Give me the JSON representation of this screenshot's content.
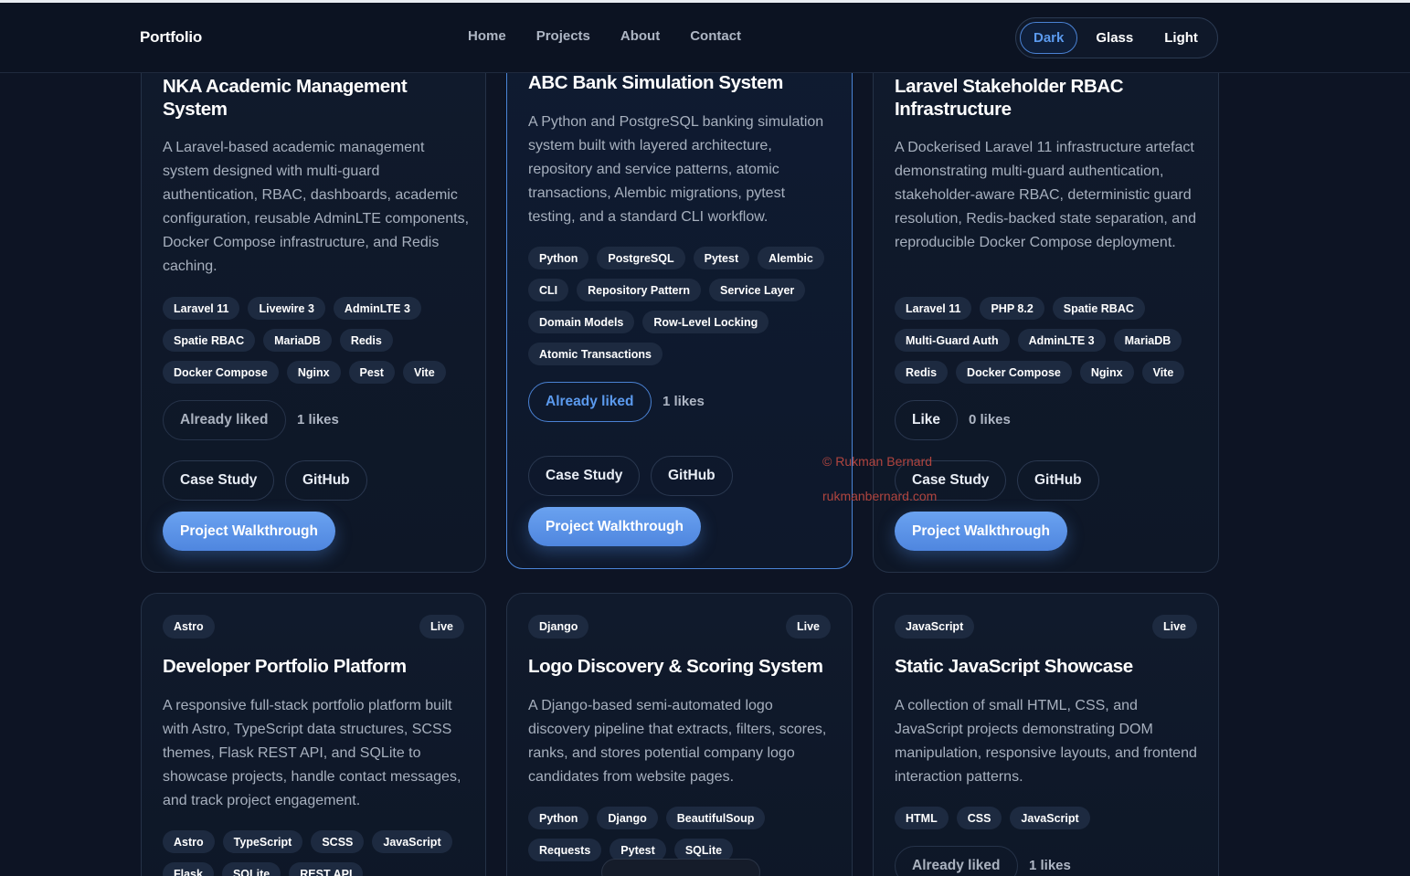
{
  "nav": {
    "brand": "Portfolio",
    "links": [
      "Home",
      "Projects",
      "About",
      "Contact"
    ],
    "themes": [
      "Dark",
      "Glass",
      "Light"
    ]
  },
  "cards": [
    {
      "title": "NKA Academic Management System",
      "description": "A Laravel-based academic management system designed with multi-guard authentication, RBAC, dashboards, academic configuration, reusable AdminLTE components, Docker Compose infrastructure, and Redis caching.",
      "tags": [
        "Laravel 11",
        "Livewire 3",
        "AdminLTE 3",
        "Spatie RBAC",
        "MariaDB",
        "Redis",
        "Docker Compose",
        "Nginx",
        "Pest",
        "Vite"
      ],
      "like_label": "Already liked",
      "likes": "1 likes",
      "case_study": "Case Study",
      "github": "GitHub",
      "walkthrough": "Project Walkthrough"
    },
    {
      "title": "ABC Bank Simulation System",
      "description": "A Python and PostgreSQL banking simulation system built with layered architecture, repository and service patterns, atomic transactions, Alembic migrations, pytest testing, and a standard CLI workflow.",
      "tags": [
        "Python",
        "PostgreSQL",
        "Pytest",
        "Alembic",
        "CLI",
        "Repository Pattern",
        "Service Layer",
        "Domain Models",
        "Row-Level Locking",
        "Atomic Transactions"
      ],
      "like_label": "Already liked",
      "likes": "1 likes",
      "case_study": "Case Study",
      "github": "GitHub",
      "walkthrough": "Project Walkthrough"
    },
    {
      "title": "Laravel Stakeholder RBAC Infrastructure",
      "description": "A Dockerised Laravel 11 infrastructure artefact demonstrating multi-guard authentication, stakeholder-aware RBAC, deterministic guard resolution, Redis-backed state separation, and reproducible Docker Compose deployment.",
      "tags": [
        "Laravel 11",
        "PHP 8.2",
        "Spatie RBAC",
        "Multi-Guard Auth",
        "AdminLTE 3",
        "MariaDB",
        "Redis",
        "Docker Compose",
        "Nginx",
        "Vite"
      ],
      "like_label": "Like",
      "likes": "0 likes",
      "case_study": "Case Study",
      "github": "GitHub",
      "walkthrough": "Project Walkthrough"
    },
    {
      "category": "Astro",
      "status": "Live",
      "title": "Developer Portfolio Platform",
      "description": "A responsive full-stack portfolio platform built with Astro, TypeScript data structures, SCSS themes, Flask REST API, and SQLite to showcase projects, handle contact messages, and track project engagement.",
      "tags": [
        "Astro",
        "TypeScript",
        "SCSS",
        "JavaScript",
        "Flask",
        "SQLite",
        "REST API"
      ]
    },
    {
      "category": "Django",
      "status": "Live",
      "title": "Logo Discovery & Scoring System",
      "description": "A Django-based semi-automated logo discovery pipeline that extracts, filters, scores, ranks, and stores potential company logo candidates from website pages.",
      "tags": [
        "Python",
        "Django",
        "BeautifulSoup",
        "Requests",
        "Pytest",
        "SQLite"
      ]
    },
    {
      "category": "JavaScript",
      "status": "Live",
      "title": "Static JavaScript Showcase",
      "description": "A collection of small HTML, CSS, and JavaScript projects demonstrating DOM manipulation, responsive layouts, and frontend interaction patterns.",
      "tags": [
        "HTML",
        "CSS",
        "JavaScript"
      ],
      "like_label": "Already liked",
      "likes": "1 likes"
    }
  ],
  "watermark": {
    "line1": "© Rukman Bernard",
    "line2": "rukmanbernard.com"
  }
}
